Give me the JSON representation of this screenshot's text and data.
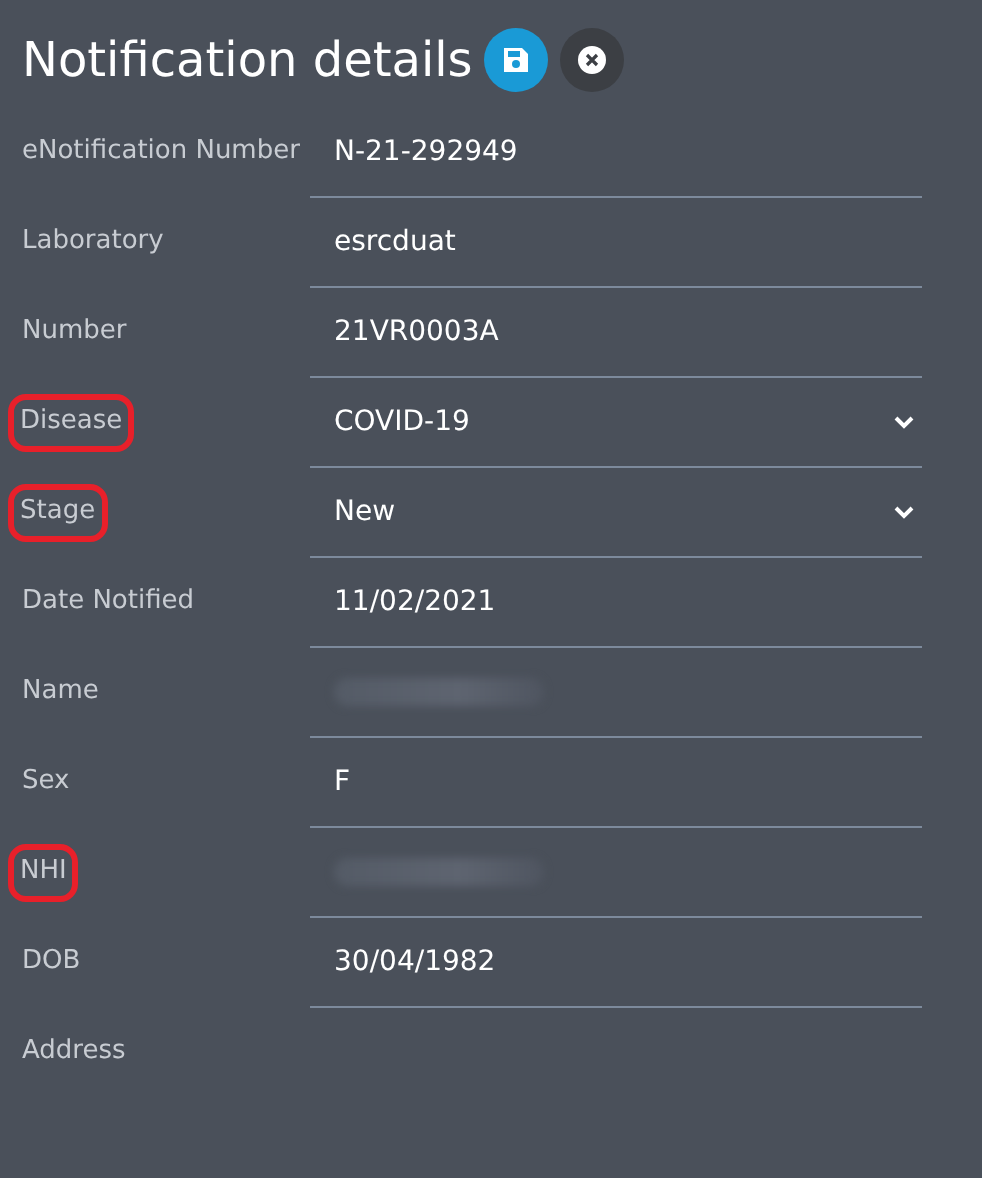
{
  "title": "Notification details",
  "actions": [
    {
      "kind": "save"
    },
    {
      "kind": "close"
    }
  ],
  "fields": [
    {
      "label": "eNotification Number",
      "kind": "text",
      "value": "N-21-292949",
      "highlighted": false
    },
    {
      "label": "Laboratory",
      "kind": "text",
      "value": "esrcduat",
      "highlighted": false
    },
    {
      "label": "Number",
      "kind": "text",
      "value": "21VR0003A",
      "highlighted": false
    },
    {
      "label": "Disease",
      "kind": "select",
      "value": "COVID-19",
      "highlighted": true
    },
    {
      "label": "Stage",
      "kind": "select",
      "value": "New",
      "highlighted": true
    },
    {
      "label": "Date Notified",
      "kind": "text",
      "value": "11/02/2021",
      "highlighted": false
    },
    {
      "label": "Name",
      "kind": "redacted",
      "highlighted": false
    },
    {
      "label": "Sex",
      "kind": "text",
      "value": "F",
      "highlighted": false
    },
    {
      "label": "NHI",
      "kind": "redacted",
      "highlighted": true
    },
    {
      "label": "DOB",
      "kind": "text",
      "value": "30/04/1982",
      "highlighted": false
    },
    {
      "label": "Address",
      "kind": "empty",
      "highlighted": false
    }
  ]
}
